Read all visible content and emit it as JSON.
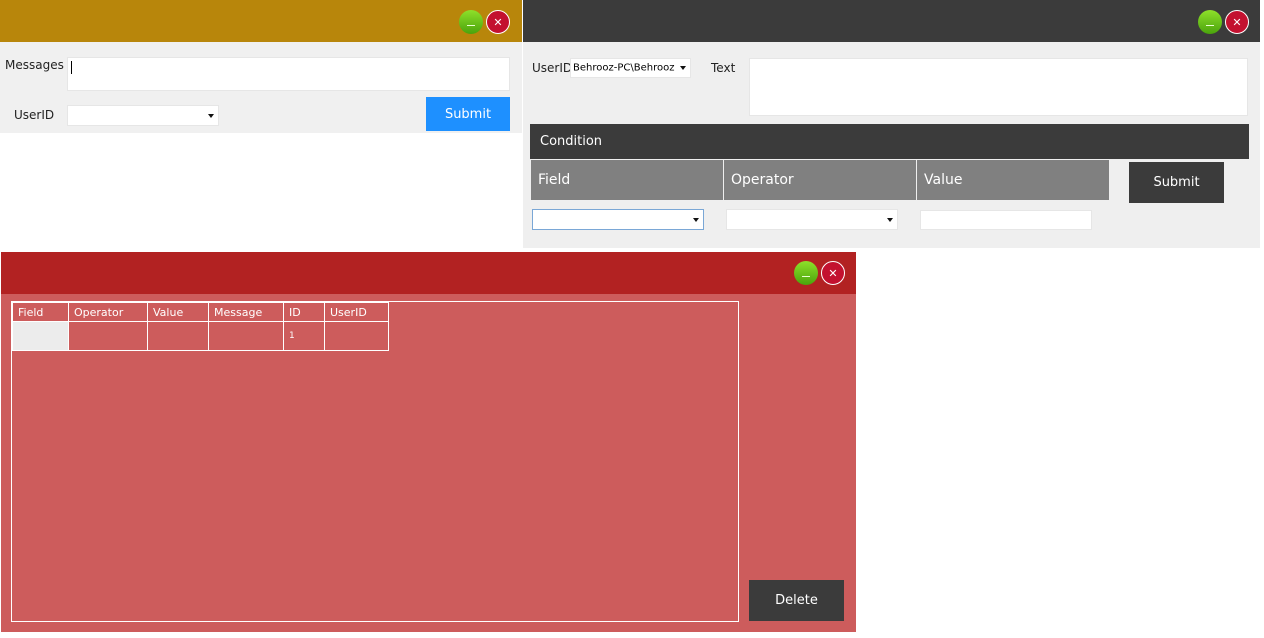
{
  "messages_window": {
    "messages_label": "Messages",
    "userid_label": "UserID",
    "userid_value": "",
    "submit_label": "Submit",
    "colors": {
      "titlebar": "#b8860b",
      "submit": "#1e90ff"
    }
  },
  "condition_window": {
    "userid_label": "UserID",
    "userid_value": "Behrooz-PC\\Behrooz",
    "text_label": "Text",
    "condition_title": "Condition",
    "columns": {
      "field": "Field",
      "operator": "Operator",
      "value": "Value"
    },
    "field_value": "",
    "operator_value": "",
    "value_value": "",
    "submit_label": "Submit",
    "colors": {
      "titlebar": "#3b3b3b",
      "column_header": "#808080"
    }
  },
  "grid_window": {
    "headers": [
      "Field",
      "Operator",
      "Value",
      "Message",
      "ID",
      "UserID"
    ],
    "rows": [
      {
        "field": "",
        "operator": "",
        "value": "",
        "message": "",
        "id": "1",
        "userid": ""
      }
    ],
    "delete_label": "Delete",
    "colors": {
      "titlebar": "#b22222",
      "body": "#cd5c5c"
    }
  },
  "window_controls": {
    "minimize": "_",
    "close": "✕"
  }
}
